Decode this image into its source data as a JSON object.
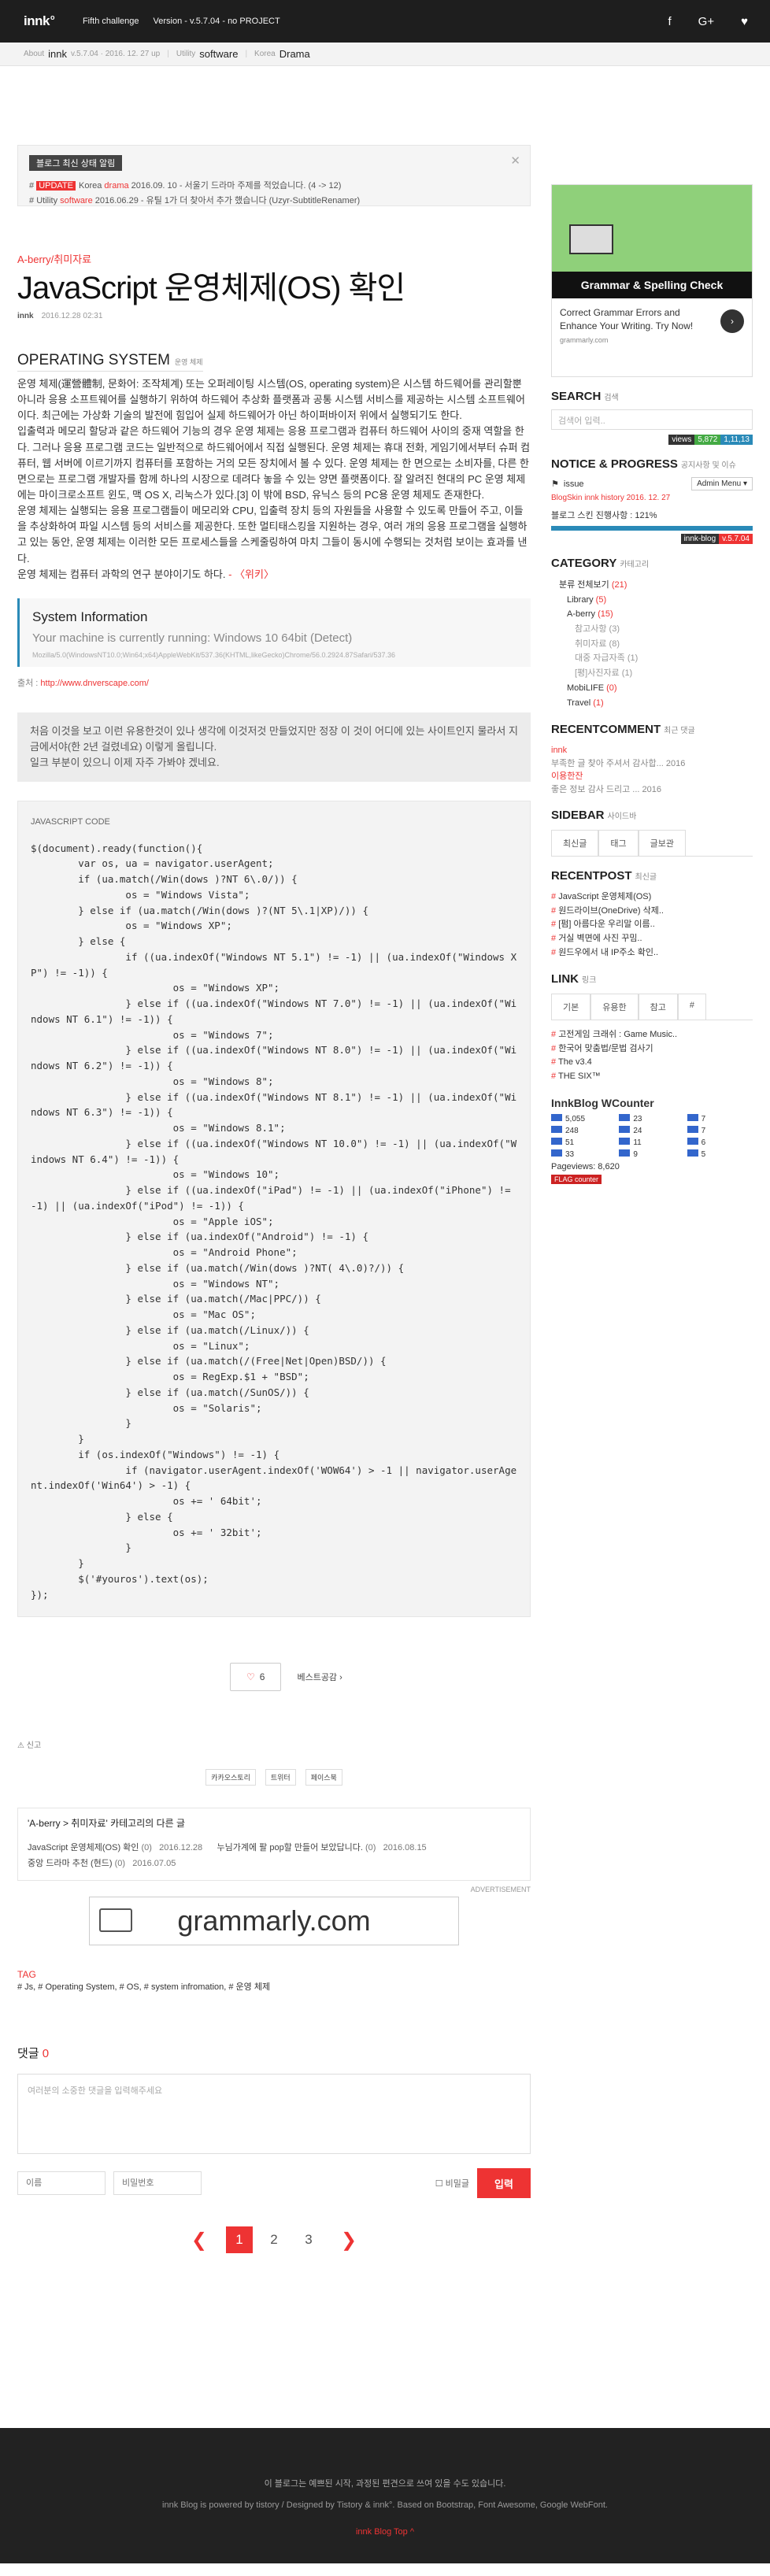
{
  "topbar": {
    "logo": "innk",
    "logo_sup": "o",
    "menu": [
      "Fifth challenge",
      "Version - v.5.7.04 - no PROJECT"
    ],
    "social": [
      "facebook-icon",
      "google-plus-icon",
      "heart-icon"
    ]
  },
  "crumb": {
    "about": "About",
    "name": "innk",
    "ver": "v.5.7.04 · 2016. 12. 27 up",
    "utility_lbl": "Utility",
    "utility": "software",
    "korea_lbl": "Korea",
    "korea": "Drama"
  },
  "notice": {
    "head": "블로그 최신 상태 알림",
    "rows": [
      {
        "prefix": "#",
        "tag": "UPDATE",
        "mid": "Korea",
        "red": "drama",
        "rest": "2016.09. 10 - 서울기 드라마 주제를 적었습니다. (4 -> 12)"
      },
      {
        "prefix": "#",
        "tag": "",
        "mid": "Utility",
        "red": "software",
        "rest": "2016.06.29 - 유틸 1가 더 찾아서 추가 했습니다 (Uzyr-SubtitleRenamer)"
      }
    ]
  },
  "post": {
    "category": "A-berry/취미자료",
    "title": "JavaScript 운영체제(OS) 확인",
    "author": "innk",
    "date": "2016.12.28 02:31"
  },
  "section": {
    "title": "OPERATING SYSTEM",
    "sub": "운영 체제"
  },
  "paragraphs": [
    "운영 체제(運營體制, 문화어: 조작체계) 또는 오퍼레이팅 시스템(OS, operating system)은 시스템 하드웨어를 관리할뿐 아니라 응용 소프트웨어를 실행하기 위하여 하드웨어 추상화 플랫폼과 공통 시스템 서비스를 제공하는 시스템 소프트웨어이다. 최근에는 가상화 기술의 발전에 힘입어 실제 하드웨어가 아닌 하이퍼바이저 위에서 실행되기도 한다.",
    "입출력과 메모리 할당과 같은 하드웨어 기능의 경우 운영 체제는 응용 프로그램과 컴퓨터 하드웨어 사이의 중재 역할을 한다. 그러나 응용 프로그램 코드는 일반적으로 하드웨어에서 직접 실행된다. 운영 체제는 휴대 전화, 게임기에서부터 슈퍼 컴퓨터, 웹 서버에 이르기까지 컴퓨터를 포함하는 거의 모든 장치에서 볼 수 있다. 운영 체제는 한 면으로는 소비자를, 다른 한 면으로는 프로그램 개발자를 함께 하나의 시장으로 데려다 놓을 수 있는 양면 플랫폼이다. 잘 알려진 현대의 PC 운영 체제에는 마이크로소프트 윈도, 맥 OS X, 리눅스가 있다.[3] 이 밖에 BSD, 유닉스 등의 PC용 운영 체제도 존재한다.",
    "운영 체제는 실행되는 응용 프로그램들이 메모리와 CPU, 입출력 장치 등의 자원들을 사용할 수 있도록 만들어 주고, 이들을 추상화하여 파일 시스템 등의 서비스를 제공한다. 또한 멀티태스킹을 지원하는 경우, 여러 개의 응용 프로그램을 실행하고 있는 동안, 운영 체제는 이러한 모든 프로세스들을 스케줄링하여 마치 그들이 동시에 수행되는 것처럼 보이는 효과를 낸다.",
    "운영 체제는 컴퓨터 과학의 연구 분야이기도 하다."
  ],
  "wiki_suffix": " - 〈위키〉",
  "sysinfo": {
    "title": "System Information",
    "text": "Your machine is currently running: Windows 10 64bit (Detect)",
    "ua": "Mozilla/5.0(WindowsNT10.0;Win64;x64)AppleWebKit/537.36(KHTML,likeGecko)Chrome/56.0.2924.87Safari/537.36"
  },
  "source": {
    "label": "출처 :",
    "url": "http://www.dnverscape.com/"
  },
  "quote": [
    "처음 이것을 보고 이런 유용한것이 있나 생각에 이것저것 만들었지만 정장 이 것이 어디에 있는 사이트인지 물라서 지금에서야(한 2년 걸렸네요) 이렇게 올립니다.",
    "일크 부분이 있으니 이제 자주 가봐야 겠네요."
  ],
  "code": {
    "label": "JAVASCRIPT CODE",
    "body": "$(document).ready(function(){\n        var os, ua = navigator.userAgent;\n        if (ua.match(/Win(dows )?NT 6\\.0/)) {\n                os = \"Windows Vista\";\n        } else if (ua.match(/Win(dows )?(NT 5\\.1|XP)/)) {\n                os = \"Windows XP\";\n        } else {\n                if ((ua.indexOf(\"Windows NT 5.1\") != -1) || (ua.indexOf(\"Windows XP\") != -1)) {\n                        os = \"Windows XP\";\n                } else if ((ua.indexOf(\"Windows NT 7.0\") != -1) || (ua.indexOf(\"Windows NT 6.1\") != -1)) {\n                        os = \"Windows 7\";\n                } else if ((ua.indexOf(\"Windows NT 8.0\") != -1) || (ua.indexOf(\"Windows NT 6.2\") != -1)) {\n                        os = \"Windows 8\";\n                } else if ((ua.indexOf(\"Windows NT 8.1\") != -1) || (ua.indexOf(\"Windows NT 6.3\") != -1)) {\n                        os = \"Windows 8.1\";\n                } else if ((ua.indexOf(\"Windows NT 10.0\") != -1) || (ua.indexOf(\"Windows NT 6.4\") != -1)) {\n                        os = \"Windows 10\";\n                } else if ((ua.indexOf(\"iPad\") != -1) || (ua.indexOf(\"iPhone\") != -1) || (ua.indexOf(\"iPod\") != -1)) {\n                        os = \"Apple iOS\";\n                } else if (ua.indexOf(\"Android\") != -1) {\n                        os = \"Android Phone\";\n                } else if (ua.match(/Win(dows )?NT( 4\\.0)?/)) {\n                        os = \"Windows NT\";\n                } else if (ua.match(/Mac|PPC/)) {\n                        os = \"Mac OS\";\n                } else if (ua.match(/Linux/)) {\n                        os = \"Linux\";\n                } else if (ua.match(/(Free|Net|Open)BSD/)) {\n                        os = RegExp.$1 + \"BSD\";\n                } else if (ua.match(/SunOS/)) {\n                        os = \"Solaris\";\n                }\n        }\n        if (os.indexOf(\"Windows\") != -1) {\n                if (navigator.userAgent.indexOf('WOW64') > -1 || navigator.userAgent.indexOf('Win64') > -1) {\n                        os += ' 64bit';\n                } else {\n                        os += ' 32bit';\n                }\n        }\n        $('#youros').text(os);\n});"
  },
  "like": {
    "count": "6",
    "best": "베스트공감 ›"
  },
  "share": {
    "label": "신고",
    "buttons": [
      "카카오스토리",
      "트위터",
      "페이스북"
    ]
  },
  "related": {
    "title": "'A-berry > 취미자료' 카테고리의 다른 글",
    "rows": [
      {
        "a": "JavaScript 운영체제(OS) 확인",
        "a_n": "(0)",
        "a_d": "2016.12.28",
        "b": "누님가계에 팔 pop할 만들어 보았답니다.",
        "b_n": "(0)",
        "b_d": "2016.08.15"
      },
      {
        "a": "중앙 드라마 추천 (현드)",
        "a_n": "(0)",
        "a_d": "2016.07.05",
        "b": "",
        "b_n": "",
        "b_d": ""
      }
    ]
  },
  "ad": {
    "label": "ADVERTISEMENT",
    "brand": "grammarly.com"
  },
  "tags": {
    "label": "TAG",
    "items": "# Js, # Operating System, # OS, # system infromation, # 운영 체제"
  },
  "comment": {
    "label": "댓글",
    "count": "0",
    "placeholder": "여러분의 소중한 댓글을 입력해주세요",
    "name_ph": "이름",
    "pw_ph": "비밀번호",
    "secret": "비밀글",
    "submit": "입력"
  },
  "pager": {
    "pages": [
      "1",
      "2",
      "3"
    ],
    "current": "1"
  },
  "footer": {
    "line1": "이 블로그는 예쁘된 시작, 과정된 편견으로 쓰여 있을 수도 있습니다.",
    "line2": "innk Blog is powered by tistory / Designed by Tistory & innk°. Based on Bootstrap, Font Awesome, Google WebFont.",
    "top": "innk Blog Top"
  },
  "side": {
    "ad_title": "Grammar & Spelling Check",
    "ad_desc": "Correct Grammar Errors and Enhance Your Writing. Try Now!",
    "ad_url": "grammarly.com",
    "search_h": "SEARCH",
    "search_sub": "검색",
    "search_ph": "검색어 입력..",
    "views": [
      "views",
      "5,872",
      "1,11,13"
    ],
    "notice_h": "NOTICE & PROGRESS",
    "notice_sub": "공지사항 및 이슈",
    "issue": "issue",
    "admin": "Admin Menu ▾",
    "issue_link": "BlogSkin innk history 2016. 12. 27",
    "skin": "블로그 스킨 진행사항 : 121%",
    "skin_pct": 1.0,
    "skin_ver": [
      "innk-blog",
      "v.5.7.04"
    ],
    "cat_h": "CATEGORY",
    "cat_sub": "카테고리",
    "cats": [
      {
        "t": "분류 전체보기",
        "c": "(21)",
        "lvl": 1
      },
      {
        "t": "Library",
        "c": "(5)",
        "lvl": 2
      },
      {
        "t": "A-berry",
        "c": "(15)",
        "lvl": 2
      },
      {
        "t": "참고사항",
        "c": "(3)",
        "lvl": 3
      },
      {
        "t": "취미자료",
        "c": "(8)",
        "lvl": 3
      },
      {
        "t": "대중 자급자족",
        "c": "(1)",
        "lvl": 3
      },
      {
        "t": "[평]사진자료",
        "c": "(1)",
        "lvl": 3
      },
      {
        "t": "MobiLIFE",
        "c": "(0)",
        "lvl": 2
      },
      {
        "t": "Travel",
        "c": "(1)",
        "lvl": 2
      }
    ],
    "rc_h": "RECENTCOMMENT",
    "rc_sub": "최근 댓글",
    "rc": [
      {
        "r": "innk",
        "t": "부족한 글 찾아 주셔서 감사합... 2016"
      },
      {
        "r": "이용한잔",
        "t": "좋은 정보 감사 드리고 ... 2016"
      }
    ],
    "sb_h": "SIDEBAR",
    "sb_sub": "사이드바",
    "sb_tabs": [
      "최신글",
      "태그",
      "글보관"
    ],
    "rp_h": "RECENTPOST",
    "rp_sub": "최신글",
    "rp": [
      "JavaScript 운영체제(OS)",
      "원드라이브(OneDrive) 삭제..",
      "[펌] 아름다운 우리말 이름..",
      "거실 벽면에 사진 꾸밈..",
      "원드우에서 내 IP주소 확인.."
    ],
    "link_h": "LINK",
    "link_sub": "링크",
    "link_tabs": [
      "기본",
      "유용한",
      "참고",
      "#"
    ],
    "links": [
      "고전게임 크래쉬 : Game Music..",
      "한국어 맞춤법/문법 검사기",
      "The v3.4",
      "THE SIX™"
    ],
    "counter_h": "InnkBlog WCounter",
    "counter": [
      [
        "5,055",
        "23",
        "7"
      ],
      [
        "248",
        "24",
        "7"
      ],
      [
        "51",
        "11",
        "6"
      ],
      [
        "33",
        "9",
        "5"
      ]
    ],
    "pageviews": "Pageviews: 8,620",
    "flag": "FLAG counter"
  }
}
